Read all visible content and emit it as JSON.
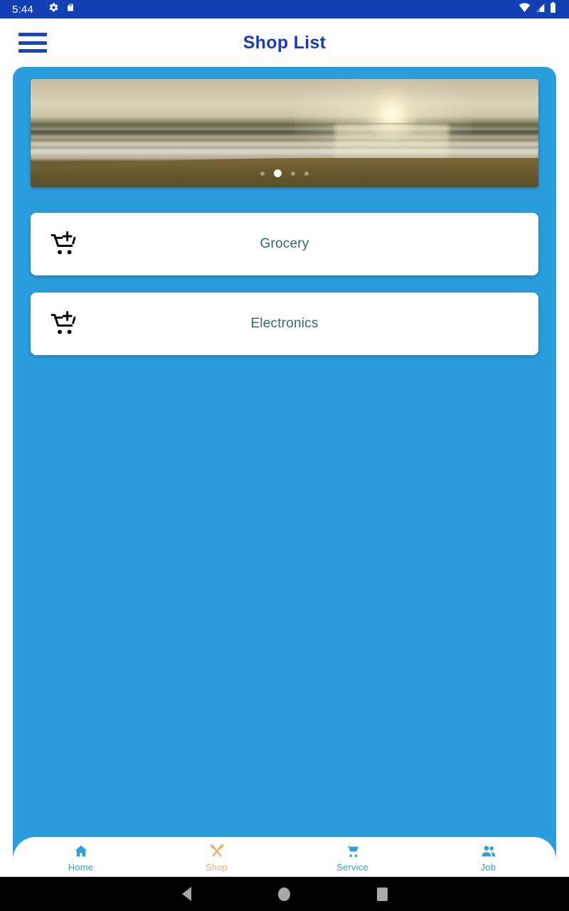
{
  "statusbar": {
    "time": "5:44",
    "left_icons": [
      "gear-icon",
      "sd-card-icon"
    ],
    "right_icons": [
      "wifi-icon",
      "cellular-signal-icon",
      "battery-icon"
    ],
    "background_color": "#1241b5"
  },
  "appbar": {
    "menu_icon": "hamburger-menu-icon",
    "title": "Shop List",
    "title_color": "#1a3cb8",
    "background_color": "#ffffff"
  },
  "content": {
    "background_color": "#2a9edc"
  },
  "carousel": {
    "image_description": "beach sunset over ocean",
    "dot_count": 4,
    "active_dot_index": 1
  },
  "categories": [
    {
      "label": "Grocery",
      "icon": "add-shopping-cart-icon"
    },
    {
      "label": "Electronics",
      "icon": "add-shopping-cart-icon"
    }
  ],
  "bottom_nav": {
    "items": [
      {
        "label": "Home",
        "icon": "home-icon",
        "active": false,
        "color": "#2fa0d8"
      },
      {
        "label": "Shop",
        "icon": "tools-icon",
        "active": true,
        "color": "#e8b273"
      },
      {
        "label": "Service",
        "icon": "cart-icon",
        "active": false,
        "color": "#2fa0d8"
      },
      {
        "label": "Job",
        "icon": "people-icon",
        "active": false,
        "color": "#2fa0d8"
      }
    ]
  },
  "android_nav": {
    "buttons": [
      "back-button",
      "home-button",
      "recents-button"
    ]
  }
}
